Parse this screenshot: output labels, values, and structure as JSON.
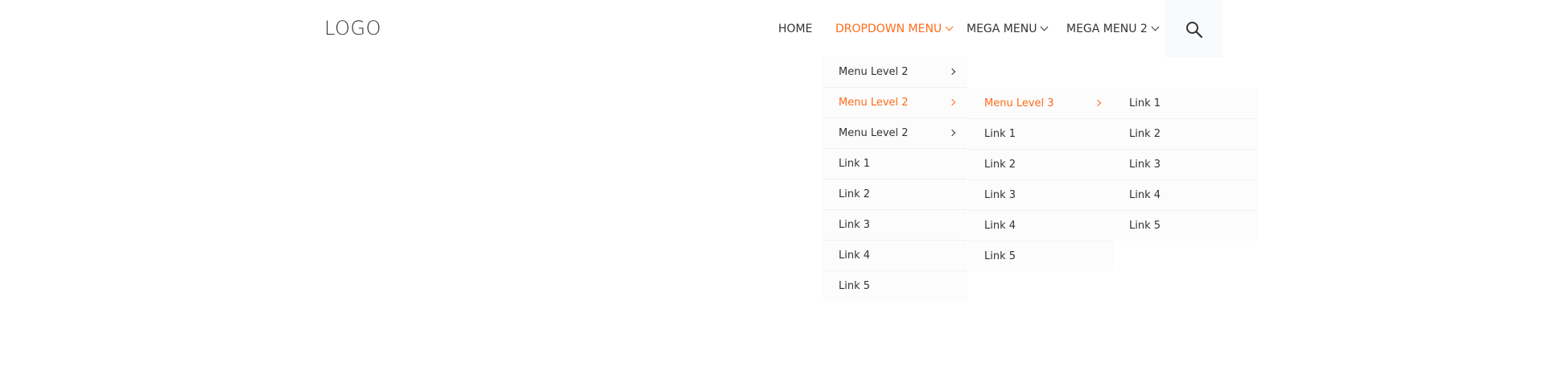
{
  "header": {
    "logo": "LOGO",
    "nav": [
      {
        "label": "HOME"
      },
      {
        "label": "DROPDOWN MENU"
      },
      {
        "label": "MEGA MENU"
      },
      {
        "label": "MEGA MENU 2"
      }
    ],
    "search_icon": "search-icon"
  },
  "colors": {
    "accent": "#ff6b1a",
    "text": "#333333",
    "menu_bg": "#fcfcfc",
    "search_bg": "#f9fafb"
  },
  "dropdown": {
    "level1": [
      "Menu Level 2",
      "Menu Level 2",
      "Menu Level 2",
      "Link 1",
      "Link 2",
      "Link 3",
      "Link 4",
      "Link 5"
    ],
    "level2": [
      "Menu Level 3",
      "Link 1",
      "Link 2",
      "Link 3",
      "Link 4",
      "Link 5"
    ],
    "level3": [
      "Link 1",
      "Link 2",
      "Link 3",
      "Link 4",
      "Link 5"
    ]
  }
}
